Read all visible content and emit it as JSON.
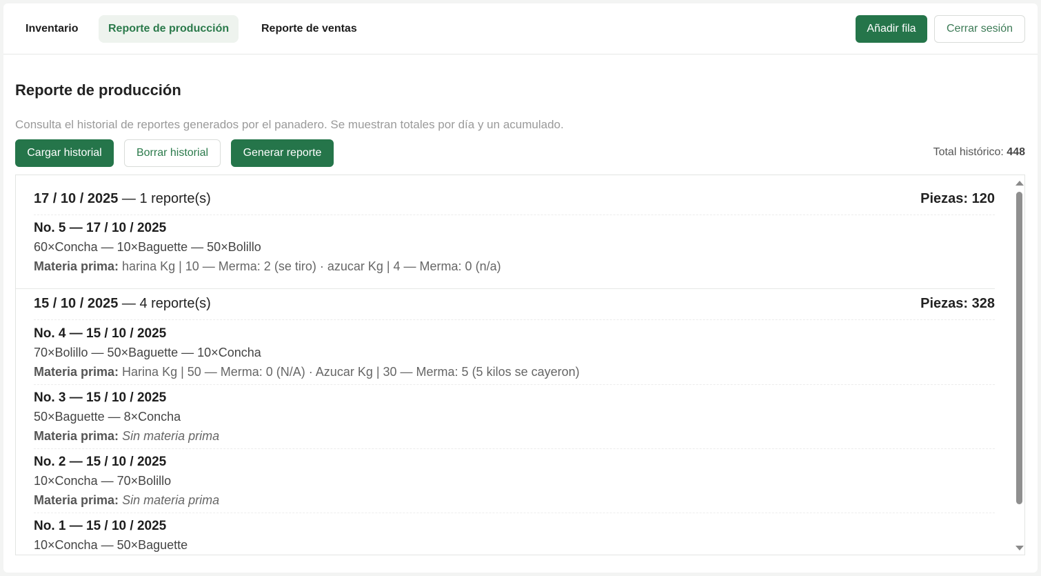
{
  "nav": {
    "tabs": [
      {
        "label": "Inventario"
      },
      {
        "label": "Reporte de producción"
      },
      {
        "label": "Reporte de ventas"
      }
    ],
    "add_row_label": "Añadir fila",
    "logout_label": "Cerrar sesión"
  },
  "page": {
    "title": "Reporte de producción",
    "subtitle": "Consulta el historial de reportes generados por el panadero. Se muestran totales por día y un acumulado.",
    "load_history_label": "Cargar historial",
    "clear_history_label": "Borrar historial",
    "generate_report_label": "Generar reporte",
    "total_label": "Total histórico:",
    "total_value": "448"
  },
  "days": [
    {
      "date": "17 / 10 / 2025",
      "count_text": " — 1 reporte(s)",
      "pieces": "Piezas: 120",
      "reports": [
        {
          "title": "No. 5 — 17 / 10 / 2025",
          "items": "60×Concha — 10×Baguette — 50×Bolillo",
          "mat_label": "Materia prima:",
          "mat_value": " harina Kg | 10 — Merma: 2 (se tiro) · azucar Kg | 4 — Merma: 0 (n/a)"
        }
      ]
    },
    {
      "date": "15 / 10 / 2025",
      "count_text": " — 4 reporte(s)",
      "pieces": "Piezas: 328",
      "reports": [
        {
          "title": "No. 4 — 15 / 10 / 2025",
          "items": "70×Bolillo — 50×Baguette — 10×Concha",
          "mat_label": "Materia prima:",
          "mat_value": " Harina Kg | 50 — Merma: 0 (N/A) · Azucar Kg | 30 — Merma: 5 (5 kilos se cayeron)"
        },
        {
          "title": "No. 3 — 15 / 10 / 2025",
          "items": "50×Baguette — 8×Concha",
          "mat_label": "Materia prima:",
          "mat_empty": "Sin materia prima"
        },
        {
          "title": "No. 2 — 15 / 10 / 2025",
          "items": "10×Concha — 70×Bolillo",
          "mat_label": "Materia prima:",
          "mat_empty": "Sin materia prima"
        },
        {
          "title": "No. 1 — 15 / 10 / 2025",
          "items": "10×Concha — 50×Baguette"
        }
      ]
    }
  ],
  "colors": {
    "accent": "#25754a",
    "active_tab_bg": "#eef3ee"
  }
}
